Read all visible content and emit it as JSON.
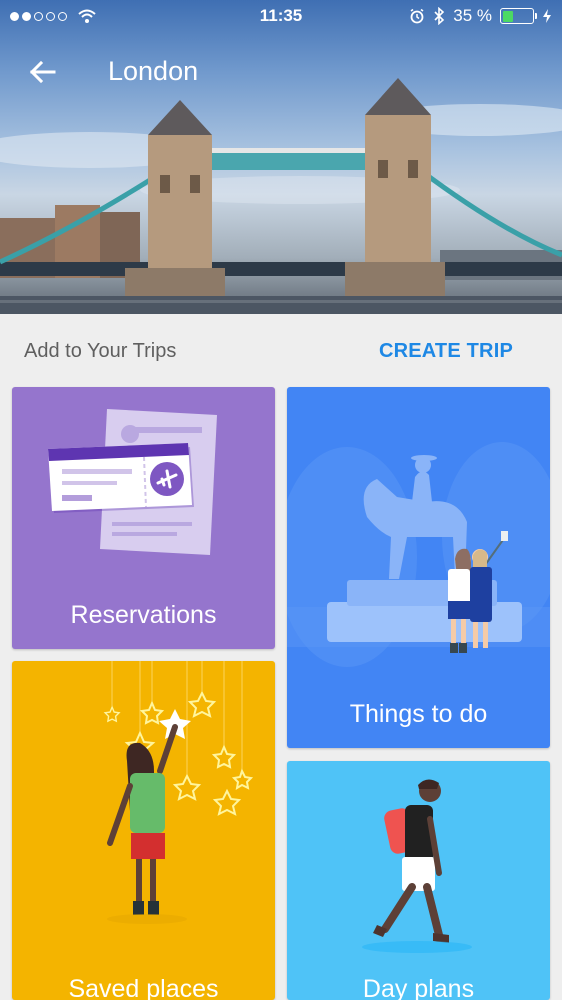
{
  "status_bar": {
    "time": "11:35",
    "battery": "35 %",
    "battery_level": 0.35
  },
  "app_bar": {
    "title": "London",
    "back_icon": "arrow-back-icon"
  },
  "section": {
    "label": "Add to Your Trips",
    "action": "CREATE TRIP"
  },
  "cards": {
    "reservations": {
      "label": "Reservations",
      "color": "#9575cd"
    },
    "things_to_do": {
      "label": "Things to do",
      "color": "#4285f4"
    },
    "saved_places": {
      "label": "Saved places",
      "color": "#f4b400"
    },
    "day_plans": {
      "label": "Day plans",
      "color": "#4fc3f7"
    }
  },
  "colors": {
    "accent": "#1e88e5"
  }
}
